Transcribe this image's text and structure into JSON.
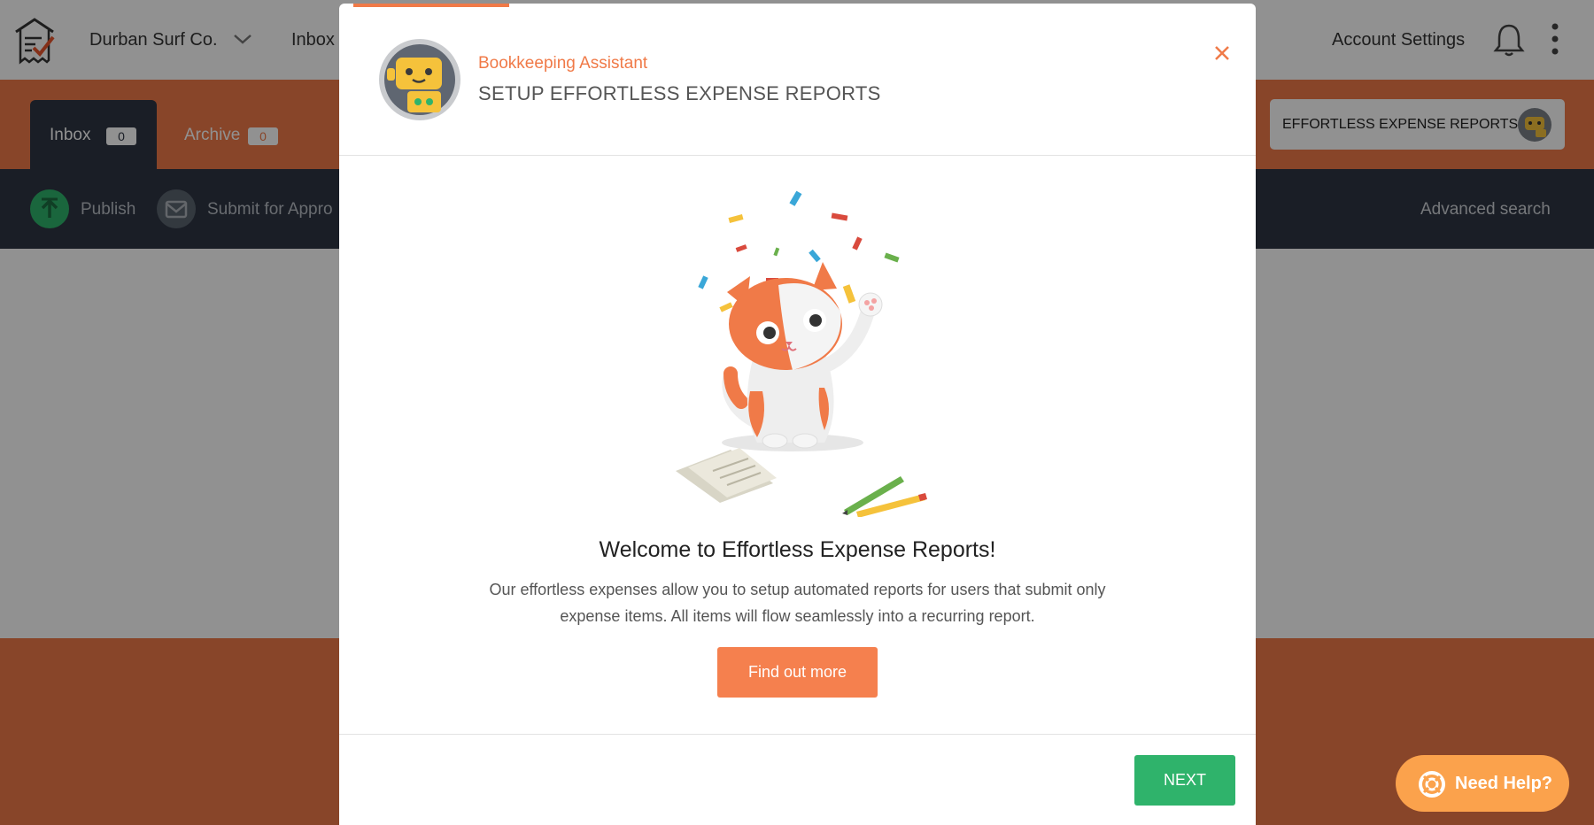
{
  "app": {
    "company_name": "Durban Surf Co.",
    "top_nav_inbox": "Inbox",
    "account_settings": "Account Settings"
  },
  "tabs": [
    {
      "label": "Inbox",
      "count": "0"
    },
    {
      "label": "Archive",
      "count": "0"
    }
  ],
  "feature_button": {
    "label": "EFFORTLESS EXPENSE REPORTS"
  },
  "actions": {
    "publish": "Publish",
    "submit": "Submit for Appro",
    "advanced_search": "Advanced search"
  },
  "modal": {
    "assistant_name": "Bookkeeping Assistant",
    "title": "SETUP EFFORTLESS EXPENSE REPORTS",
    "heading": "Welcome to Effortless Expense Reports!",
    "description": "Our effortless expenses allow you to setup automated reports for users that submit only expense items. All items will flow seamlessly into a recurring report.",
    "find_out_more": "Find out more",
    "next": "NEXT"
  },
  "help": {
    "label": "Need Help?"
  },
  "colors": {
    "brand_orange": "#f07a48",
    "dark_navy": "#2e3643",
    "success_green": "#2fb36b",
    "help_orange": "#fba24c"
  },
  "icons": [
    "receipt-logo-icon",
    "chevron-down-icon",
    "bell-icon",
    "kebab-menu-icon",
    "robot-icon",
    "upload-icon",
    "submit-approval-icon",
    "close-icon",
    "lifebuoy-icon"
  ]
}
